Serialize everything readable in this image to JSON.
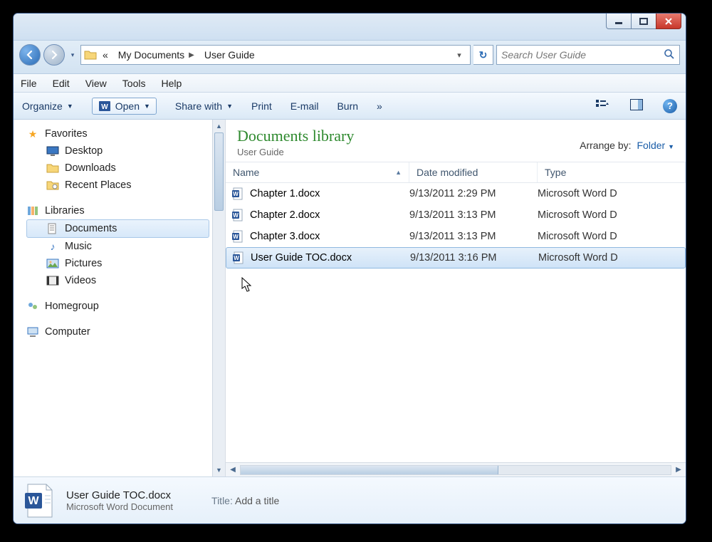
{
  "window_controls": {
    "minimize": "—",
    "maximize": "❐",
    "close": "✕"
  },
  "nav": {
    "history_dropdown": "▾"
  },
  "address": {
    "prefix": "«",
    "crumbs": [
      "My Documents",
      "User Guide"
    ],
    "dropdown": "▾",
    "refresh": "↻"
  },
  "search": {
    "placeholder": "Search User Guide"
  },
  "menubar": [
    "File",
    "Edit",
    "View",
    "Tools",
    "Help"
  ],
  "toolbar": {
    "organize": "Organize",
    "open": "Open",
    "share": "Share with",
    "print": "Print",
    "email": "E-mail",
    "burn": "Burn",
    "overflow": "»"
  },
  "navpane": {
    "favorites": {
      "label": "Favorites",
      "items": [
        "Desktop",
        "Downloads",
        "Recent Places"
      ]
    },
    "libraries": {
      "label": "Libraries",
      "items": [
        "Documents",
        "Music",
        "Pictures",
        "Videos"
      ],
      "selected": "Documents"
    },
    "homegroup": {
      "label": "Homegroup"
    },
    "computer": {
      "label": "Computer"
    }
  },
  "library": {
    "title": "Documents library",
    "subtitle": "User Guide",
    "arrange_label": "Arrange by:",
    "arrange_value": "Folder"
  },
  "columns": {
    "name": "Name",
    "date": "Date modified",
    "type": "Type"
  },
  "files": [
    {
      "name": "Chapter 1.docx",
      "date": "9/13/2011 2:29 PM",
      "type": "Microsoft Word D"
    },
    {
      "name": "Chapter 2.docx",
      "date": "9/13/2011 3:13 PM",
      "type": "Microsoft Word D"
    },
    {
      "name": "Chapter 3.docx",
      "date": "9/13/2011 3:13 PM",
      "type": "Microsoft Word D"
    },
    {
      "name": "User Guide TOC.docx",
      "date": "9/13/2011 3:16 PM",
      "type": "Microsoft Word D"
    }
  ],
  "selected_index": 3,
  "details": {
    "name": "User Guide TOC.docx",
    "type": "Microsoft Word Document",
    "title_label": "Title:",
    "title_value": "Add a title"
  }
}
